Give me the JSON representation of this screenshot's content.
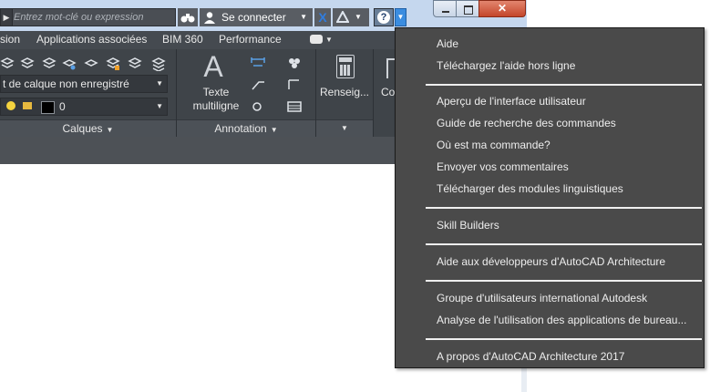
{
  "titlebar": {
    "search_placeholder": "Entrez mot-clé ou expression",
    "signin_label": "Se connecter"
  },
  "ribbon_tabs": [
    "sion",
    "Applications associées",
    "BIM 360",
    "Performance"
  ],
  "panels": {
    "calques": {
      "title": "Calques",
      "layer_state": "t de calque non enregistré",
      "layer_value": "0"
    },
    "annotation": {
      "title": "Annotation",
      "text_line1": "Texte",
      "text_line2": "multiligne"
    },
    "renseignements": {
      "label": "Renseig..."
    },
    "next_panel": {
      "label": "Co"
    }
  },
  "help_menu": {
    "groups": [
      [
        "Aide",
        "Téléchargez l'aide hors ligne"
      ],
      [
        "Aperçu de l'interface utilisateur",
        "Guide de recherche des commandes",
        "Où est ma commande?",
        "Envoyer vos commentaires",
        "Télécharger des modules linguistiques"
      ],
      [
        "Skill Builders"
      ],
      [
        "Aide aux développeurs d'AutoCAD Architecture"
      ],
      [
        "Groupe d'utilisateurs international Autodesk",
        "Analyse de l'utilisation des applications de bureau..."
      ],
      [
        "A propos d'AutoCAD Architecture 2017"
      ]
    ]
  },
  "colors": {
    "menu_bg": "#4a4a4a",
    "ribbon_bg": "#3f4449",
    "titlebar_bg": "#c5d7ee",
    "accent": "#3b8de0"
  }
}
